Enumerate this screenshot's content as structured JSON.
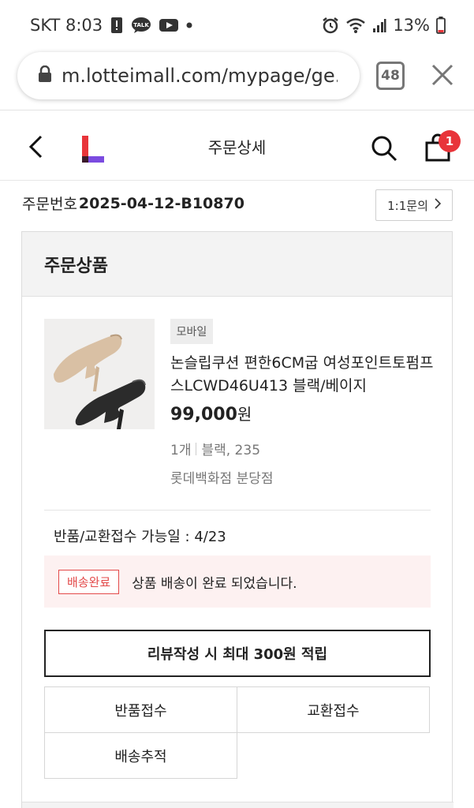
{
  "status_bar": {
    "carrier_time": "SKT 8:03",
    "battery": "13%"
  },
  "url_bar": {
    "url": "m.lotteimall.com/mypage/ge...",
    "tab_count": "48"
  },
  "header": {
    "title": "주문상세",
    "cart_count": "1"
  },
  "order": {
    "number_label": "주문번호",
    "number": "2025-04-12-B10870",
    "inquiry_label": "1:1문의"
  },
  "card": {
    "title": "주문상품",
    "product": {
      "channel_tag": "모바일",
      "name": "논슬립쿠션 편한6CM굽 여성포인트토펌프스LCWD46U413 블랙/베이지",
      "price": "99,000",
      "currency": "원",
      "quantity": "1개",
      "option": "블랙, 235",
      "store": "롯데백화점 분당점"
    },
    "return_date": "반품/교환접수 가능일 : 4/23",
    "delivery_status": {
      "badge": "배송완료",
      "message": "상품 배송이 완료 되었습니다."
    },
    "review_button": "리뷰작성 시 최대 300원 적립",
    "actions": {
      "return": "반품접수",
      "exchange": "교환접수",
      "tracking": "배송추적"
    }
  },
  "colors": {
    "accent_red": "#e8343a",
    "status_bg": "#fdf1f1"
  }
}
